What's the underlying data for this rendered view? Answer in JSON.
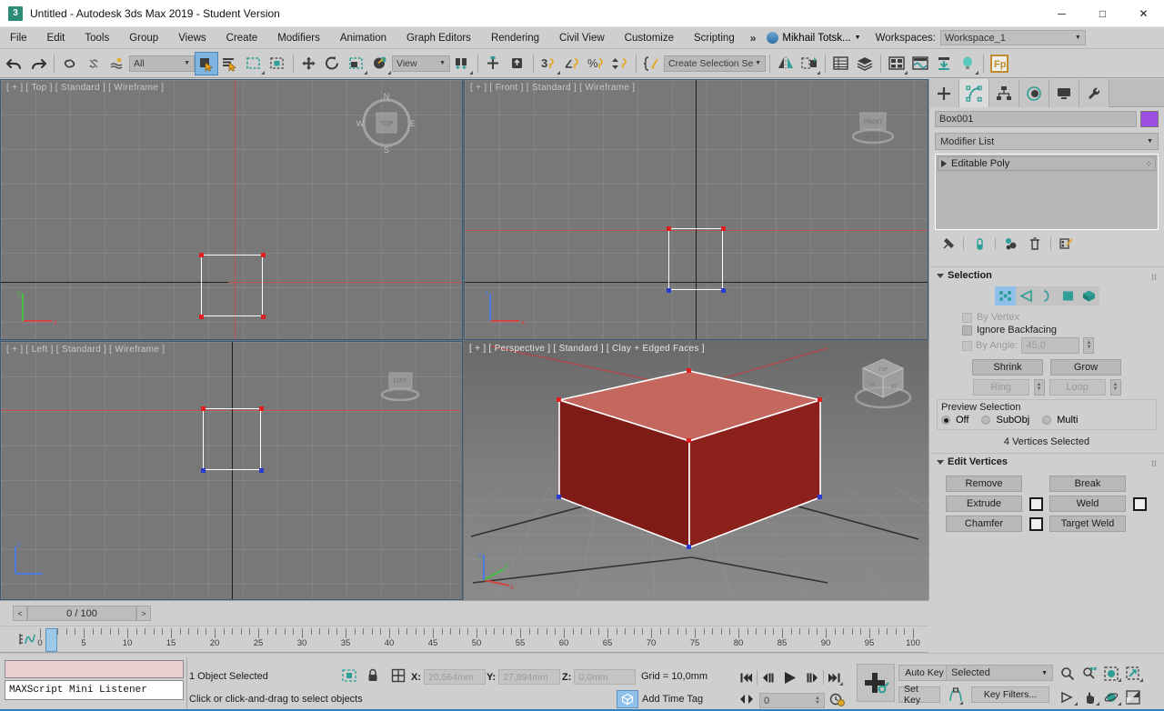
{
  "window": {
    "title": "Untitled - Autodesk 3ds Max 2019 - Student Version",
    "app_badge": "3",
    "minimize": "─",
    "maximize": "□",
    "close": "✕"
  },
  "menubar": {
    "items": [
      {
        "label": "File"
      },
      {
        "label": "Edit"
      },
      {
        "label": "Tools"
      },
      {
        "label": "Group"
      },
      {
        "label": "Views"
      },
      {
        "label": "Create"
      },
      {
        "label": "Modifiers"
      },
      {
        "label": "Animation"
      },
      {
        "label": "Graph Editors"
      },
      {
        "label": "Rendering"
      },
      {
        "label": "Civil View"
      },
      {
        "label": "Customize"
      },
      {
        "label": "Scripting"
      }
    ],
    "overflow": "»",
    "user": "Mikhail Totsk...",
    "workspaces_label": "Workspaces:",
    "workspace_value": "Workspace_1"
  },
  "toolbar": {
    "undo": "undo-arrow-icon",
    "redo": "redo-arrow-icon",
    "select_filter": "All",
    "ref_coord": "View",
    "selection_set": "Create Selection Se"
  },
  "viewports": [
    {
      "id": "top",
      "label": "[ + ] [ Top ] [ Standard ] [ Wireframe ]",
      "navcube": "compass"
    },
    {
      "id": "front",
      "label": "[ + ] [ Front ] [ Standard ] [ Wireframe ]",
      "navcube": "front-puck"
    },
    {
      "id": "left",
      "label": "[ + ] [ Left ] [ Standard ] [ Wireframe ]",
      "navcube": "left-puck"
    },
    {
      "id": "perspective",
      "label": "[ + ] [ Perspective ] [ Standard ] [ Clay + Edged Faces ]",
      "navcube": "viewcube"
    }
  ],
  "navcube": {
    "top_face": "TOP",
    "front_face": "FRONT",
    "left_face": "LEFT",
    "compass_n": "N",
    "compass_s": "S",
    "compass_e": "E",
    "compass_w": "W"
  },
  "command_panel": {
    "tabs": [
      {
        "name": "create",
        "icon": "plus-icon",
        "active": false
      },
      {
        "name": "modify",
        "icon": "modify-bent-icon",
        "active": true
      },
      {
        "name": "hierarchy",
        "icon": "hierarchy-icon",
        "active": false
      },
      {
        "name": "motion",
        "icon": "motion-wheel-icon",
        "active": false
      },
      {
        "name": "display",
        "icon": "display-monitor-icon",
        "active": false
      },
      {
        "name": "utilities",
        "icon": "wrench-icon",
        "active": false
      }
    ],
    "object_name": "Box001",
    "object_color": "#9d4de0",
    "modifier_list_label": "Modifier List",
    "modifier_stack": [
      {
        "label": "Editable Poly"
      }
    ],
    "stack_tools": [
      "pin-stack-icon",
      "show-end-result-icon",
      "make-unique-icon",
      "remove-modifier-icon",
      "configure-sets-icon"
    ],
    "selection_rollout": {
      "title": "Selection",
      "sub_objects": [
        "vertex-icon",
        "edge-icon",
        "border-icon",
        "polygon-icon",
        "element-icon"
      ],
      "active_sub_object": "vertex-icon",
      "by_vertex": "By Vertex",
      "ignore_backfacing": "Ignore Backfacing",
      "by_angle": "By Angle:",
      "by_angle_value": "45,0",
      "shrink": "Shrink",
      "grow": "Grow",
      "ring": "Ring",
      "loop": "Loop",
      "preview_selection": "Preview Selection",
      "preview_options": [
        "Off",
        "SubObj",
        "Multi"
      ],
      "preview_selected": "Off",
      "status": "4 Vertices Selected"
    },
    "edit_vertices_rollout": {
      "title": "Edit Vertices",
      "buttons": [
        "Remove",
        "Break",
        "Extrude",
        "Weld",
        "Chamfer",
        "Target Weld"
      ]
    }
  },
  "timeslider": {
    "prev": "<",
    "next": ">",
    "current": "0 / 100",
    "ticks": [
      0,
      5,
      10,
      15,
      20,
      25,
      30,
      35,
      40,
      45,
      50,
      55,
      60,
      65,
      70,
      75,
      80,
      85,
      90,
      95,
      100
    ],
    "handle_frame": 0
  },
  "statusbar": {
    "maxscript_listener": "MAXScript Mini Listener",
    "selection": "1 Object Selected",
    "hint": "Click or click-and-drag to select objects",
    "x_label": "X:",
    "x_value": "20,564mm",
    "y_label": "Y:",
    "y_value": "27,894mm",
    "z_label": "Z:",
    "z_value": "0,0mm",
    "grid": "Grid = 10,0mm",
    "add_time_tag": "Add Time Tag",
    "auto_key": "Auto Key",
    "set_key": "Set Key",
    "key_mode": "Selected",
    "key_filters": "Key Filters...",
    "frame_field": "0",
    "playback_icons": [
      "goto-start-icon",
      "prev-frame-icon",
      "play-icon",
      "next-frame-icon",
      "goto-end-icon"
    ],
    "nav_icons": [
      "zoom-icon",
      "zoom-all-icon",
      "zoom-extents-icon",
      "zoom-region-icon",
      "field-of-view-icon",
      "pan-icon",
      "orbit-icon",
      "maximize-viewport-icon"
    ]
  },
  "colors": {
    "viewport_bg": "#787878",
    "active_outline": "#ffff00",
    "cube_side": "#8c1f1a",
    "cube_top": "#c4685f",
    "vertex_selected": "#e02020",
    "vertex_unselected": "#2a3ccf",
    "accent_teal": "#2e9e96",
    "panel_bg": "#cfcfcf"
  }
}
